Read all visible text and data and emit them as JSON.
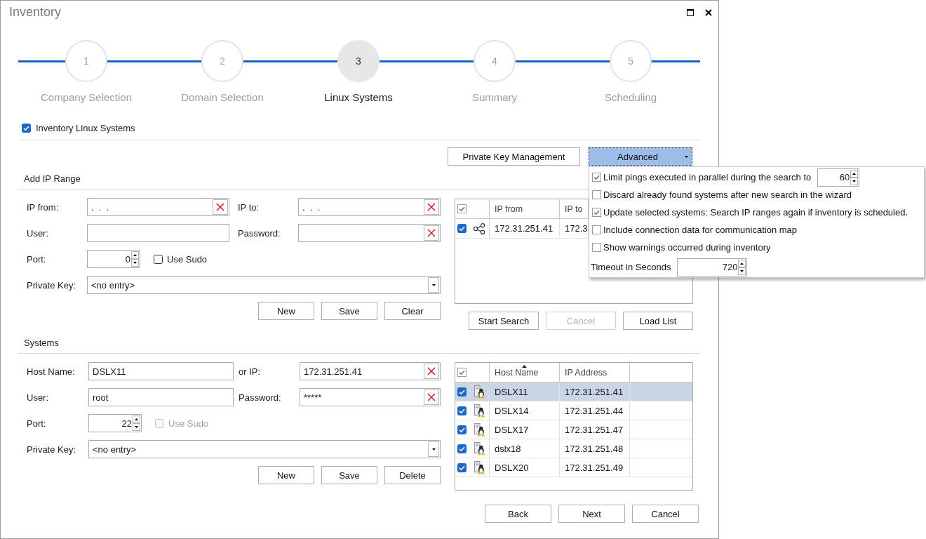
{
  "window": {
    "title": "Inventory"
  },
  "steps": [
    {
      "number": "1",
      "label": "Company Selection",
      "selected": false
    },
    {
      "number": "2",
      "label": "Domain Selection",
      "selected": false
    },
    {
      "number": "3",
      "label": "Linux Systems",
      "selected": true
    },
    {
      "number": "4",
      "label": "Summary",
      "selected": false
    },
    {
      "number": "5",
      "label": "Scheduling",
      "selected": false
    }
  ],
  "inventory_option": {
    "label": "Inventory Linux Systems",
    "checked": true
  },
  "toolbar": [
    {
      "kind": "button",
      "label": "Private Key Management"
    },
    {
      "kind": "dropdown",
      "label": "Advanced",
      "expanded": true
    }
  ],
  "advanced_menu": [
    {
      "kind": "check_spin",
      "label": "Limit pings executed in parallel during the search to",
      "checked": true,
      "value": "60"
    },
    {
      "kind": "check",
      "label": "Discard already found systems after new search in the wizard",
      "checked": false
    },
    {
      "kind": "check",
      "label": "Update selected systems: Search IP ranges again if inventory is scheduled.",
      "checked": true
    },
    {
      "kind": "check",
      "label": "Include connection data for communication map",
      "checked": false
    },
    {
      "kind": "check",
      "label": "Show warnings occurred during inventory",
      "checked": false
    },
    {
      "kind": "spin",
      "label": "Timeout in Seconds",
      "value": "720"
    }
  ],
  "sections": [
    {
      "kind": "ip_range",
      "title": "Add IP Range",
      "fields": [
        {
          "label": "IP from:",
          "value": ".  .  .",
          "clearable": true
        },
        {
          "label": "IP to:",
          "value": ".  .  .",
          "clearable": true
        },
        {
          "label": "User:",
          "clearable": false
        },
        {
          "label": "Password:",
          "clearable": true
        }
      ],
      "port": {
        "label": "Port:",
        "value": "0"
      },
      "use_sudo": {
        "label": "Use Sudo",
        "checked": false,
        "disabled": false
      },
      "private_key": {
        "label": "Private Key:",
        "value": "<no entry>"
      },
      "buttons": [
        "New",
        "Save",
        "Clear"
      ],
      "table": {
        "header_checked": true,
        "columns": [
          {
            "label": "IP from",
            "sorted": false
          },
          {
            "label": "IP to",
            "sorted": false
          }
        ],
        "rows": [
          {
            "checked": true,
            "selected": false,
            "cells": [
              "172.31.251.41",
              "172.3"
            ]
          }
        ]
      },
      "table_buttons": [
        {
          "label": "Start Search",
          "disabled": false
        },
        {
          "label": "Cancel",
          "disabled": true
        },
        {
          "label": "Load List",
          "disabled": false
        }
      ]
    },
    {
      "kind": "systems",
      "title": "Systems",
      "fields": [
        {
          "label": "Host Name:",
          "value": "DSLX11",
          "clearable": false
        },
        {
          "label": "or IP:",
          "value": "172.31.251.41",
          "clearable": true
        },
        {
          "label": "User:",
          "value": "root",
          "clearable": false
        },
        {
          "label": "Password:",
          "value": "*****",
          "clearable": true
        }
      ],
      "port": {
        "label": "Port:",
        "value": "22"
      },
      "use_sudo": {
        "label": "Use Sudo",
        "checked": false,
        "disabled": true
      },
      "private_key": {
        "label": "Private Key:",
        "value": "<no entry>"
      },
      "buttons": [
        "New",
        "Save",
        "Delete"
      ],
      "table": {
        "header_checked": true,
        "columns": [
          {
            "label": "Host Name",
            "sorted": true
          },
          {
            "label": "IP Address",
            "sorted": false
          }
        ],
        "rows": [
          {
            "checked": true,
            "selected": true,
            "cells": [
              "DSLX11",
              "172.31.251.41"
            ]
          },
          {
            "checked": true,
            "selected": false,
            "cells": [
              "DSLX14",
              "172.31.251.44"
            ]
          },
          {
            "checked": true,
            "selected": false,
            "cells": [
              "DSLX17",
              "172.31.251.47"
            ]
          },
          {
            "checked": true,
            "selected": false,
            "cells": [
              "dslx18",
              "172.31.251.48"
            ]
          },
          {
            "checked": true,
            "selected": false,
            "cells": [
              "DSLX20",
              "172.31.251.49"
            ]
          }
        ]
      }
    }
  ],
  "wizard_buttons": [
    "Back",
    "Next",
    "Cancel"
  ]
}
